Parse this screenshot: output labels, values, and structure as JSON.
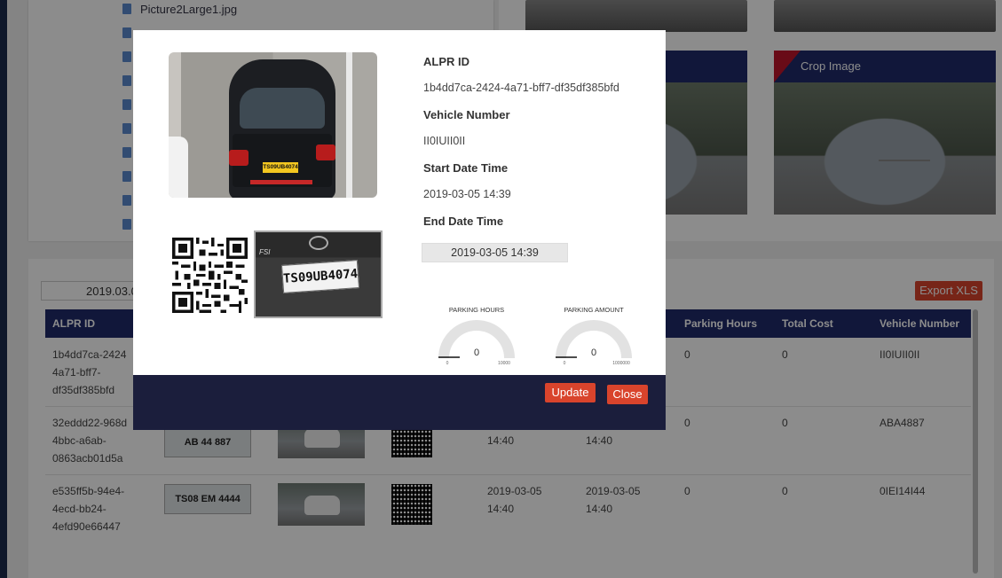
{
  "background": {
    "files": [
      "Picture2Large1.jpg"
    ],
    "crop_image_header": "Crop Image",
    "date_filter_value": "2019.03.0",
    "export_button": "Export XLS",
    "table": {
      "headers": {
        "alpr_id": "ALPR ID",
        "parking_hours": "Parking Hours",
        "total_cost": "Total Cost",
        "vehicle_number": "Vehicle Number"
      },
      "rows": [
        {
          "alpr_id": "1b4dd7ca-2424\n4a71-bff7-\ndf35df385bfd",
          "start": "",
          "end": "",
          "hours": "0",
          "cost": "0",
          "vehicle": "II0IUII0II",
          "plate": ""
        },
        {
          "alpr_id": "32eddd22-968d\n4bbc-a6ab-\n0863acb01d5a",
          "start": "14:40",
          "end": "14:40",
          "hours": "0",
          "cost": "0",
          "vehicle": "ABA4887",
          "plate": "AB 44 887"
        },
        {
          "alpr_id": "e535ff5b-94e4-\n4ecd-bb24-\n4efd90e66447",
          "start": "2019-03-05\n14:40",
          "end": "2019-03-05\n14:40",
          "hours": "0",
          "cost": "0",
          "vehicle": "0IEI14I44",
          "plate": "TS08 EM 4444"
        }
      ]
    }
  },
  "modal": {
    "plate_text": "TS09UB4074",
    "car_plate_text": "TS09UB4074",
    "car_badge": "FSI",
    "fields": {
      "alpr_id_label": "ALPR ID",
      "alpr_id_value": "1b4dd7ca-2424-4a71-bff7-df35df385bfd",
      "vehicle_number_label": "Vehicle Number",
      "vehicle_number_value": "II0IUII0II",
      "start_label": "Start Date Time",
      "start_value": "2019-03-05 14:39",
      "end_label": "End Date Time",
      "end_value": "2019-03-05 14:39"
    },
    "gauges": [
      {
        "title": "PARKING HOURS",
        "value": "0",
        "min": "0",
        "max": "10000"
      },
      {
        "title": "PARKING AMOUNT",
        "value": "0",
        "min": "0",
        "max": "1000000"
      }
    ],
    "update_button": "Update",
    "close_button": "Close"
  }
}
